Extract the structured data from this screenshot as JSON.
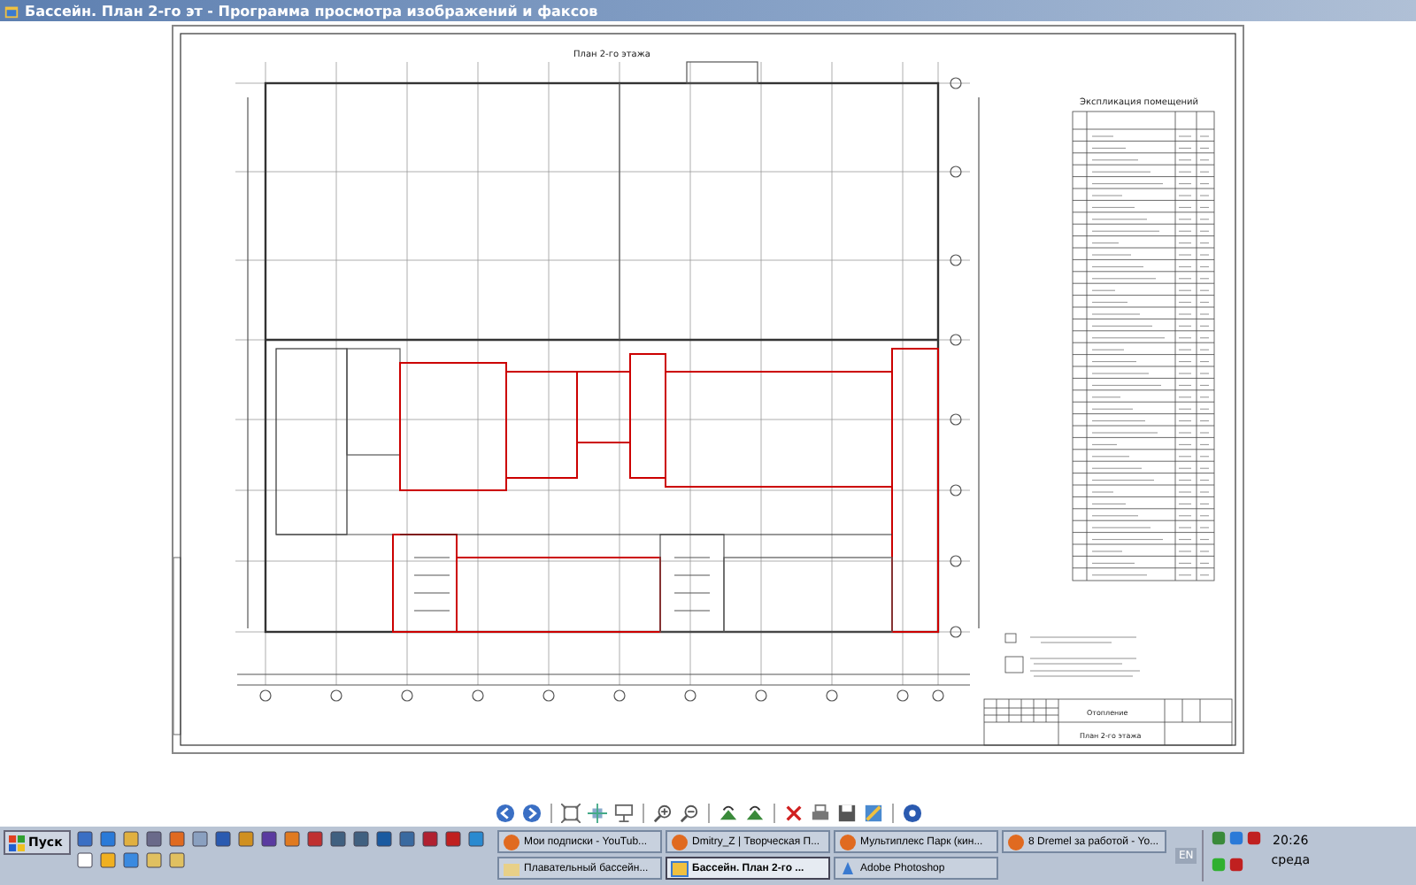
{
  "window": {
    "title": "Бассейн. План 2-го эт - Программа просмотра изображений и факсов"
  },
  "document": {
    "sheet_title": "План 2-го этажа",
    "schedule_title": "Экспликация помещений",
    "stamp_section": "Отопление",
    "stamp_sheet": "План 2-го этажа"
  },
  "taskbar": {
    "start_label": "Пуск",
    "tasks": [
      {
        "label": "Мои подписки - YouTub...",
        "kind": "browser",
        "selected": false
      },
      {
        "label": "Dmitry_Z | Творческая П...",
        "kind": "browser",
        "selected": false
      },
      {
        "label": "Мультиплекс Парк (кин...",
        "kind": "browser",
        "selected": false
      },
      {
        "label": "8 Dremel за работой - Yo...",
        "kind": "browser",
        "selected": false
      },
      {
        "label": "Плавательный бассейн...",
        "kind": "folder",
        "selected": false
      },
      {
        "label": "Бассейн. План 2-го ...",
        "kind": "viewer",
        "selected": true
      },
      {
        "label": "Adobe Photoshop",
        "kind": "photoshop",
        "selected": false
      }
    ],
    "language": "EN",
    "time": "20:26",
    "day": "среда"
  }
}
